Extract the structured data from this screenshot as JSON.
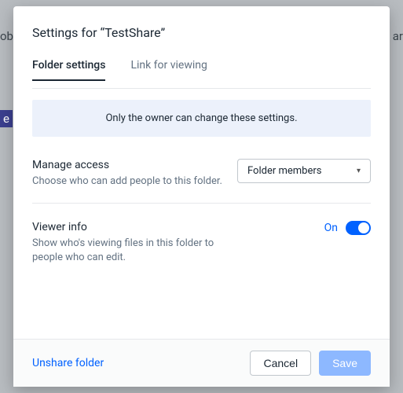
{
  "title": "Settings for “TestShare”",
  "tabs": {
    "folder": "Folder settings",
    "link": "Link for viewing"
  },
  "notice": "Only the owner can change these settings.",
  "manageAccess": {
    "label": "Manage access",
    "sub": "Choose who can add people to this folder.",
    "value": "Folder members"
  },
  "viewerInfo": {
    "label": "Viewer info",
    "sub": "Show who's viewing files in this folder to people who can edit.",
    "state": "On"
  },
  "footer": {
    "unshare": "Unshare folder",
    "cancel": "Cancel",
    "save": "Save"
  },
  "bg": {
    "left1": "ob",
    "left2": "e",
    "right1": "ar"
  }
}
